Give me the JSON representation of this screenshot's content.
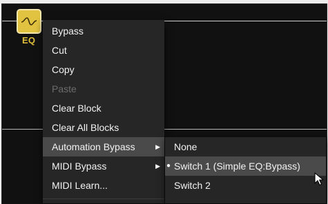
{
  "block": {
    "label": "EQ",
    "icon": "eq-curve-icon",
    "color": "#e2c341"
  },
  "context_menu": {
    "items": [
      {
        "label": "Bypass",
        "enabled": true
      },
      {
        "label": "Cut",
        "enabled": true
      },
      {
        "label": "Copy",
        "enabled": true
      },
      {
        "label": "Paste",
        "enabled": false
      },
      {
        "label": "Clear Block",
        "enabled": true
      },
      {
        "label": "Clear All Blocks",
        "enabled": true
      },
      {
        "label": "Automation Bypass",
        "enabled": true,
        "submenu": true,
        "highlighted": true
      },
      {
        "label": "MIDI Bypass",
        "enabled": true,
        "submenu": true
      },
      {
        "label": "MIDI Learn...",
        "enabled": true
      }
    ]
  },
  "submenu": {
    "items": [
      {
        "label": "None",
        "checked": false
      },
      {
        "label": "Switch 1 (Simple EQ:Bypass)",
        "checked": true,
        "highlighted": true
      },
      {
        "label": "Switch 2",
        "checked": false
      }
    ]
  }
}
